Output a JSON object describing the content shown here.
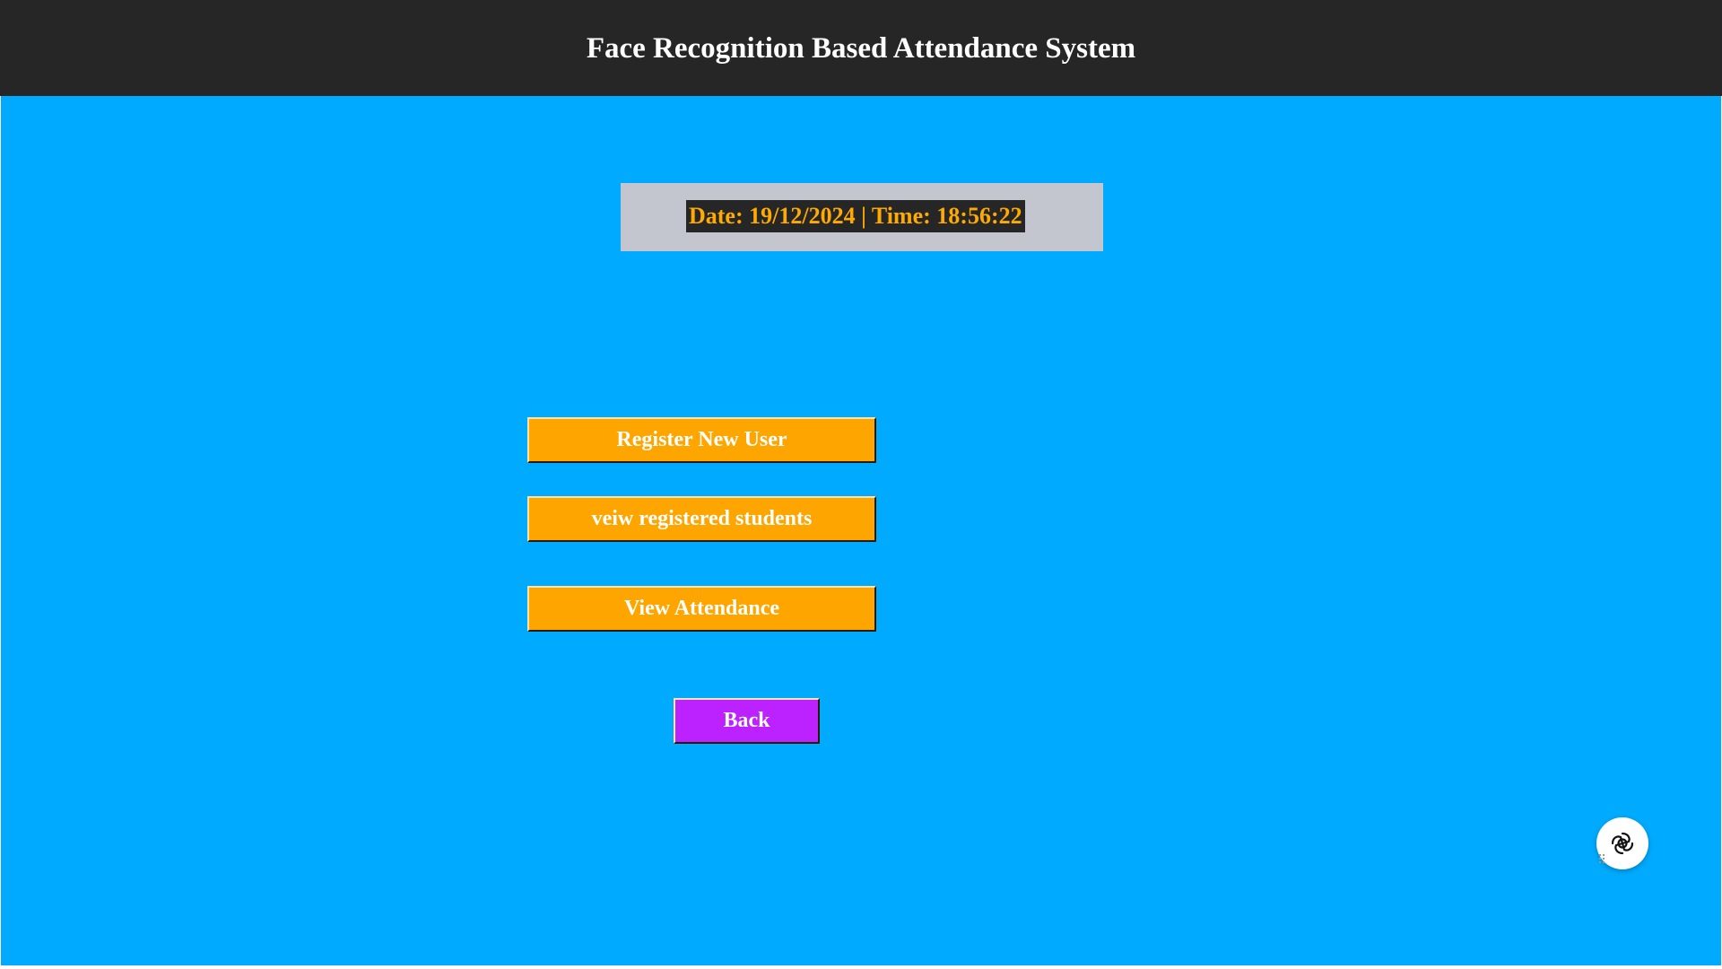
{
  "window": {
    "title": "Face Recognition Based Attendance System"
  },
  "datetime": {
    "text": "Date: 19/12/2024 | Time: 18:56:22"
  },
  "menu": {
    "register_label": "Register New User",
    "view_students_label": "veiw registered students",
    "view_attendance_label": "View Attendance",
    "back_label": "Back"
  },
  "widget": {
    "icon": "ai-assistant-icon"
  },
  "colors": {
    "title_bar": "#262626",
    "background": "#00aaff",
    "datetime_panel": "#c4c6cf",
    "datetime_text": "#ffaa00",
    "primary_button": "#ffa500",
    "back_button": "#bb22ff",
    "button_text": "#ffffff"
  }
}
